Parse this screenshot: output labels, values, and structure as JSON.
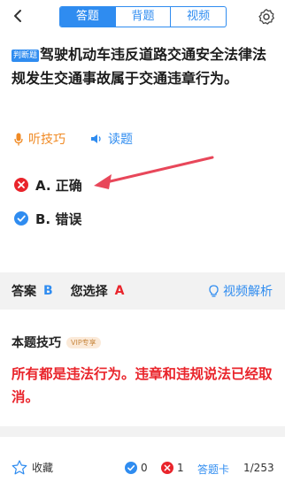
{
  "header": {
    "tabs": [
      "答题",
      "背题",
      "视频"
    ],
    "active_tab": 0
  },
  "question": {
    "type_tag": "判断题",
    "text": "驾驶机动车违反道路交通安全法律法规发生交通事故属于交通违章行为。"
  },
  "tools": {
    "listen_label": "听技巧",
    "read_label": "读题"
  },
  "options": [
    {
      "label": "A. 正确",
      "status": "wrong"
    },
    {
      "label": "B. 错误",
      "status": "correct"
    }
  ],
  "answer_bar": {
    "answer_label": "答案",
    "answer_value": "B",
    "choice_label": "您选择",
    "choice_value": "A",
    "video_label": "视频解析"
  },
  "tips": {
    "title": "本题技巧",
    "vip_badge": "VIP专享",
    "text": "所有都是违法行为。违章和违规说法已经取消。"
  },
  "bottom": {
    "favorite_label": "收藏",
    "correct_count": "0",
    "wrong_count": "1",
    "card_label": "答题卡",
    "progress": "1/253"
  },
  "colors": {
    "accent": "#2f8cf0",
    "error": "#e9242b",
    "orange": "#f08a24"
  }
}
